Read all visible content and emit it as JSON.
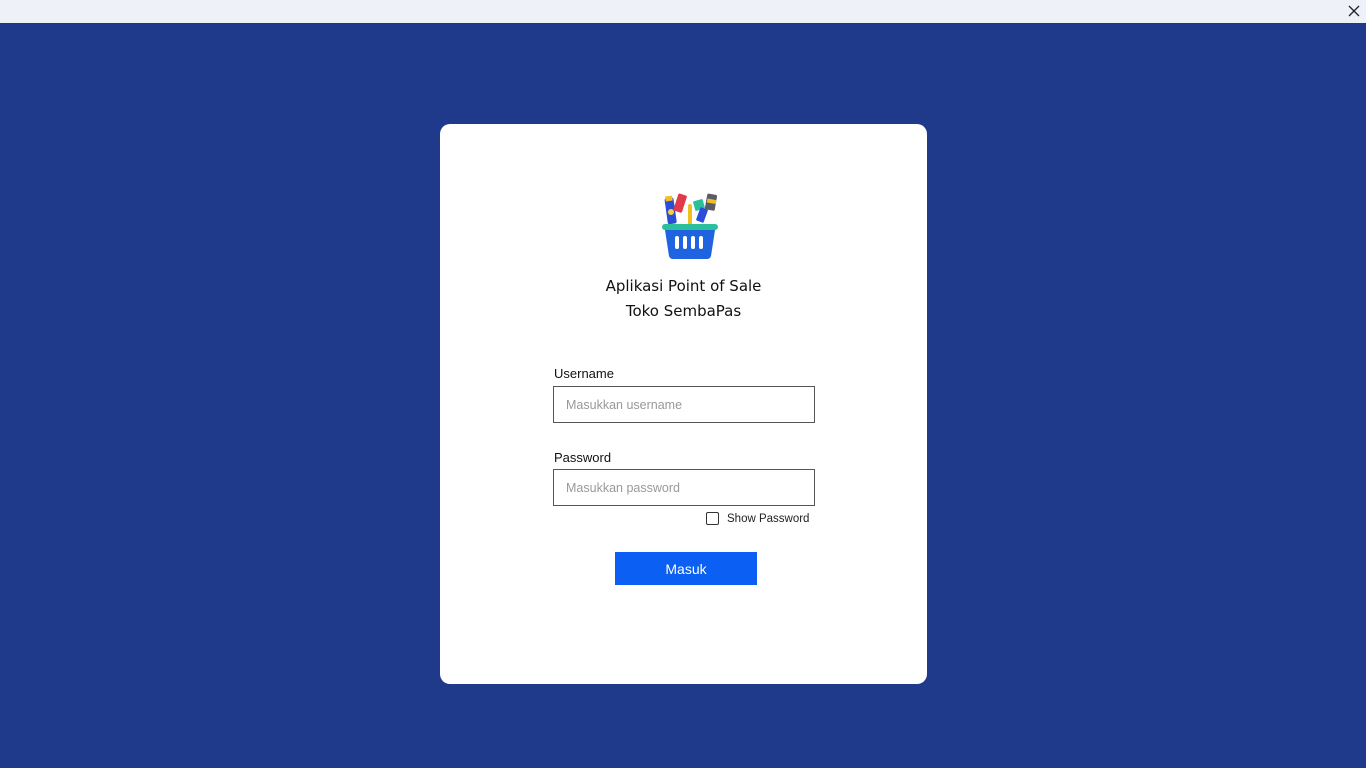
{
  "window": {
    "close_icon": "close-icon"
  },
  "brand": {
    "logo_icon": "shopping-basket-icon",
    "title_line1": "Aplikasi Point of Sale",
    "title_line2": "Toko SembaPas"
  },
  "form": {
    "username_label": "Username",
    "username_placeholder": "Masukkan username",
    "username_value": "",
    "password_label": "Password",
    "password_placeholder": "Masukkan password",
    "password_value": "",
    "show_password_label": "Show Password",
    "show_password_checked": false,
    "submit_label": "Masuk"
  },
  "colors": {
    "background": "#1f3a8a",
    "card": "#ffffff",
    "button": "#0b5ff2",
    "titlebar": "#eef2f8"
  }
}
